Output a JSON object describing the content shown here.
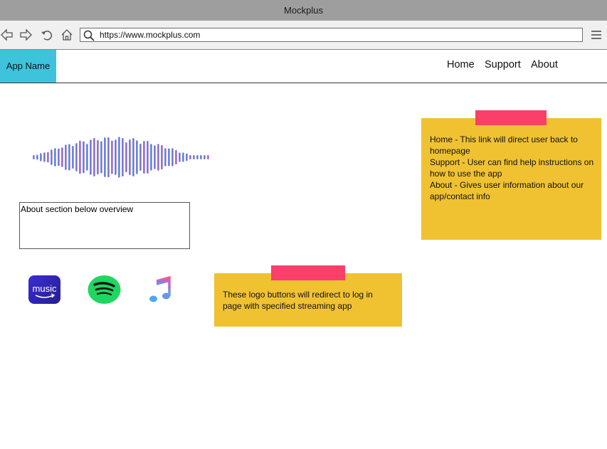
{
  "window": {
    "title": "Mockplus"
  },
  "browser": {
    "url": "https://www.mockplus.com",
    "icons": [
      "back-icon",
      "forward-icon",
      "refresh-icon",
      "home-icon",
      "search-icon",
      "hamburger-menu-icon"
    ]
  },
  "appbar": {
    "app_name": "App Name",
    "accent": "#3ec3dc",
    "nav": [
      "Home",
      "Support",
      "About"
    ]
  },
  "main": {
    "about_box_text": "About section below overview",
    "streaming_logos": [
      "amazon-music-logo",
      "spotify-logo",
      "apple-music-logo"
    ],
    "amazon_logo_text": "music"
  },
  "notes": {
    "nav_note": {
      "lines": [
        "Home - This link will direct user back to homepage",
        "Support - User can find help instructions on how to use the app",
        "About - Gives user information about our app/contact info"
      ]
    },
    "logo_note": {
      "text": "These logo buttons will redirect to log in page with specified streaming app"
    },
    "sticky_color": "#f0c232",
    "tape_color": "#fa3f6a"
  }
}
